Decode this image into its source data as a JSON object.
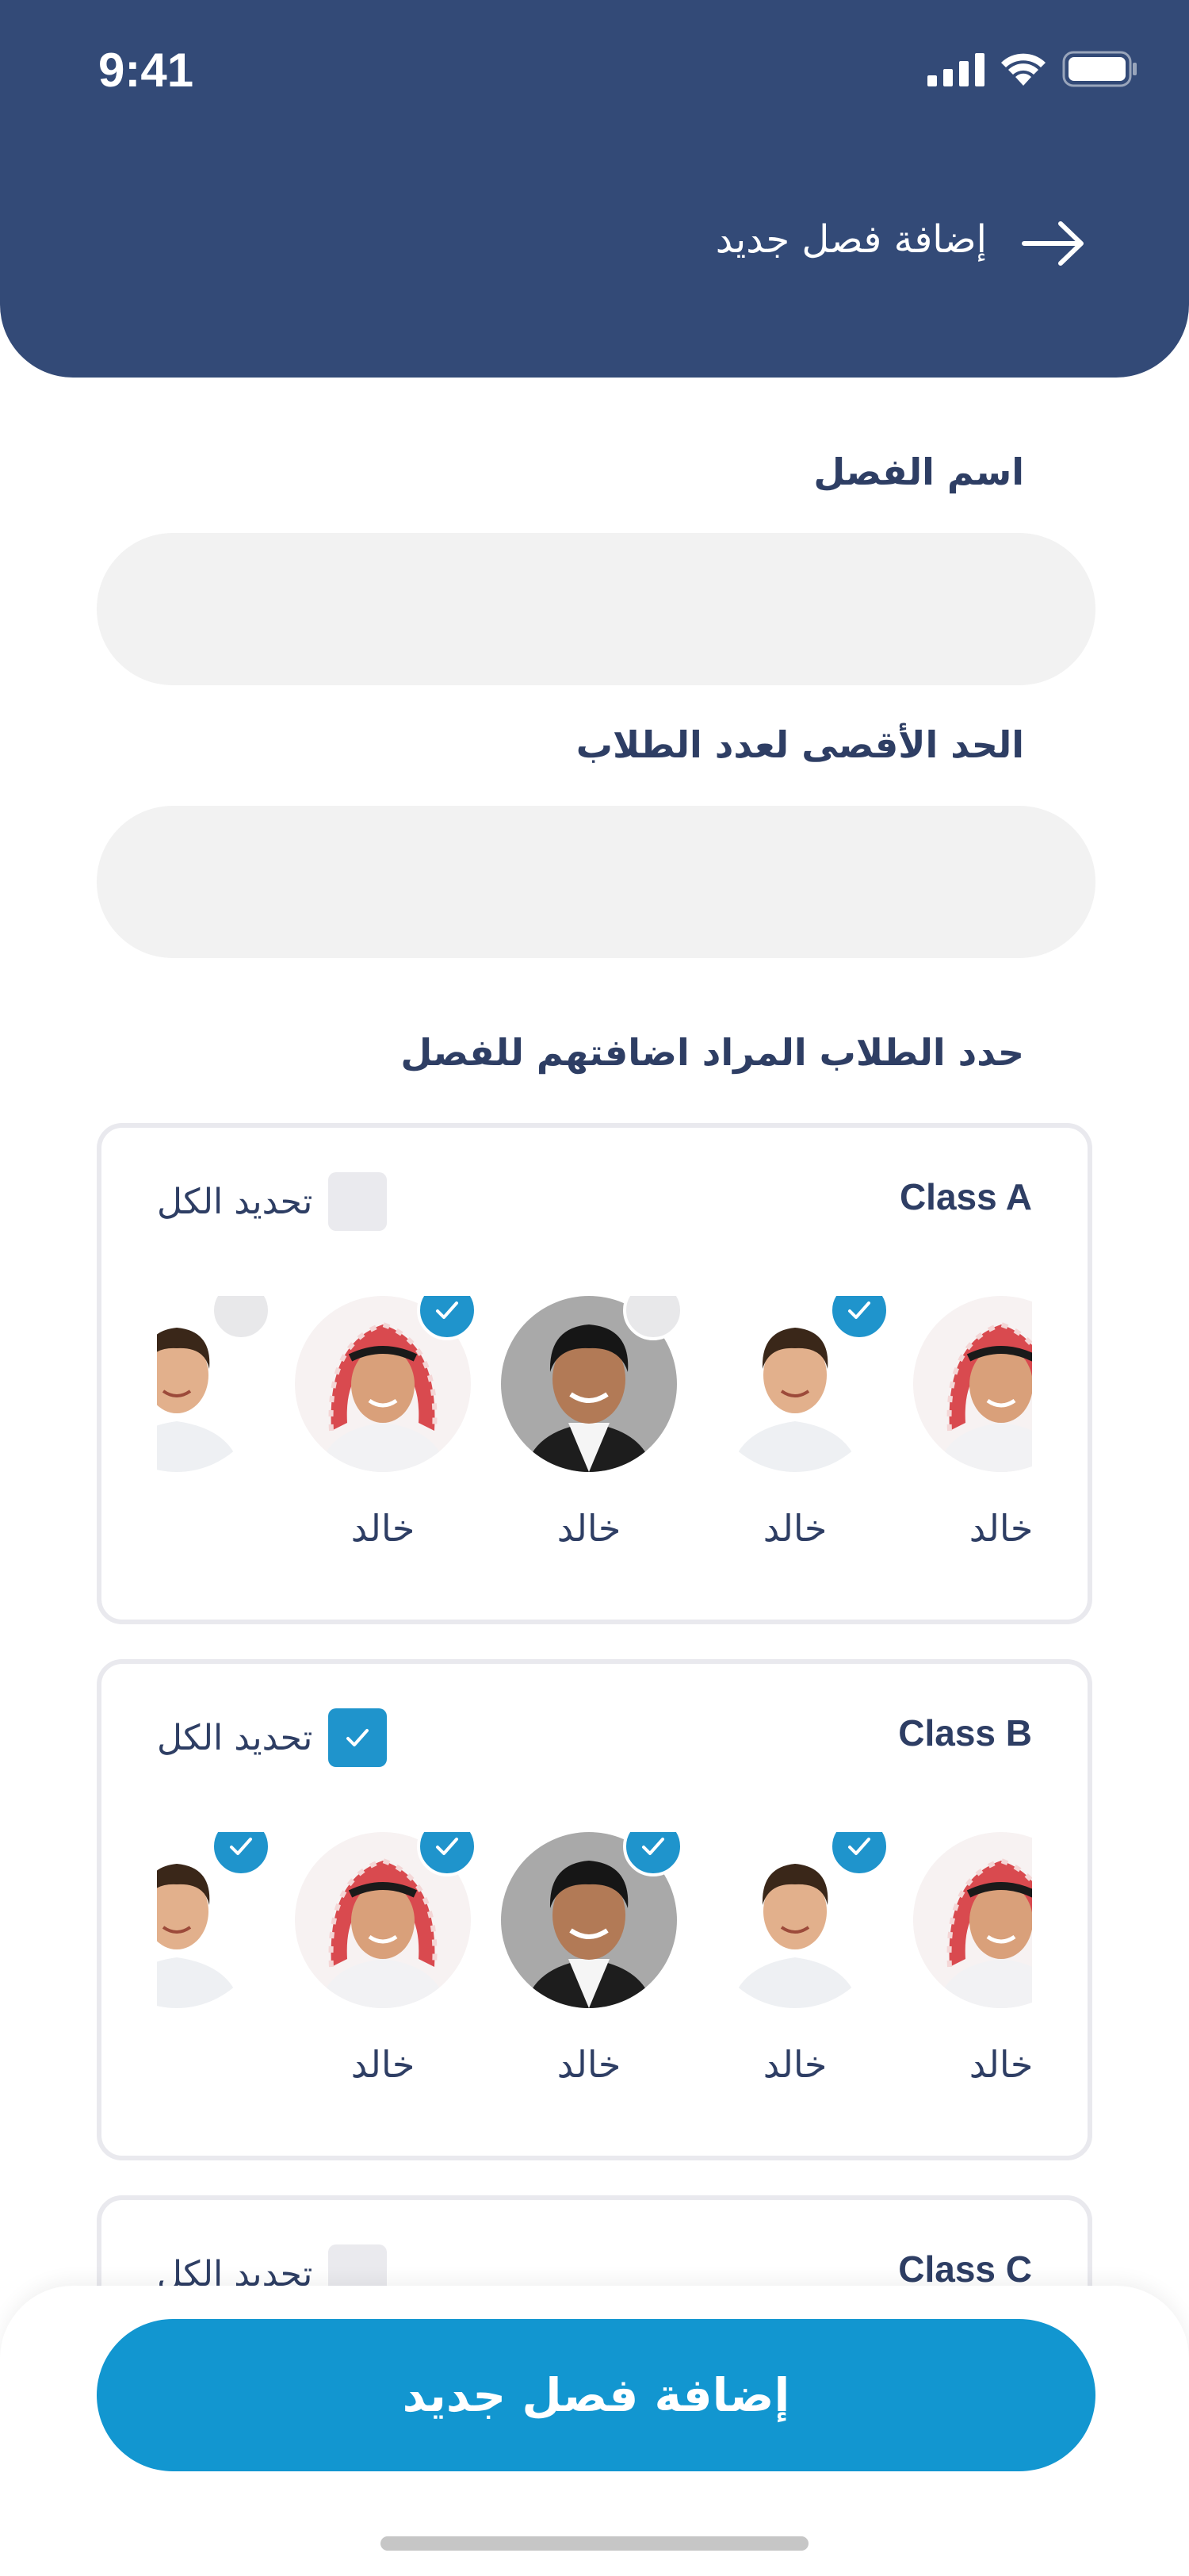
{
  "status_bar": {
    "time": "9:41"
  },
  "header": {
    "title": "إضافة فصل جديد"
  },
  "form": {
    "class_name_label": "اسم الفصل",
    "class_name_value": "",
    "max_students_label": "الحد الأقصى لعدد الطلاب",
    "max_students_value": "",
    "select_students_label": "حدد الطلاب المراد اضافتهم للفصل"
  },
  "classes": [
    {
      "name": "Class A",
      "select_all_label": "تحديد الكل",
      "select_all_checked": false,
      "students": [
        {
          "name": "خالد",
          "selected": false,
          "avatar": "boy-shemagh"
        },
        {
          "name": "خالد",
          "selected": true,
          "avatar": "boy-small"
        },
        {
          "name": "خالد",
          "selected": false,
          "avatar": "boy-gray-bg"
        },
        {
          "name": "خالد",
          "selected": true,
          "avatar": "boy-shemagh"
        },
        {
          "name": "",
          "selected": false,
          "avatar": "boy-small"
        }
      ]
    },
    {
      "name": "Class B",
      "select_all_label": "تحديد الكل",
      "select_all_checked": true,
      "students": [
        {
          "name": "خالد",
          "selected": true,
          "avatar": "boy-shemagh"
        },
        {
          "name": "خالد",
          "selected": true,
          "avatar": "boy-small"
        },
        {
          "name": "خالد",
          "selected": true,
          "avatar": "boy-gray-bg"
        },
        {
          "name": "خالد",
          "selected": true,
          "avatar": "boy-shemagh"
        },
        {
          "name": "",
          "selected": true,
          "avatar": "boy-small"
        }
      ]
    },
    {
      "name": "Class C",
      "select_all_label": "تحديد الكل",
      "select_all_checked": false,
      "students": []
    }
  ],
  "footer": {
    "button_label": "إضافة فصل جديد"
  },
  "colors": {
    "header_bg": "#334a77",
    "accent": "#1296d0",
    "text_dark": "#2e3e64",
    "input_bg": "#f2f2f2"
  }
}
